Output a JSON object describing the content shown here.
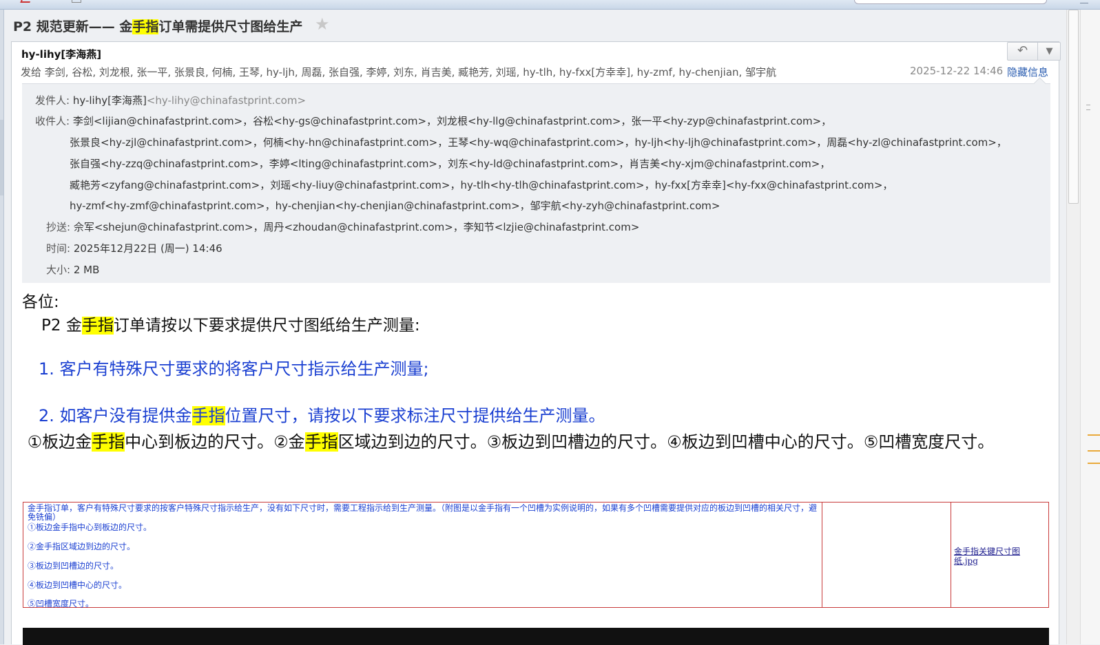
{
  "subject": {
    "before": "P2 规范更新—— 金",
    "highlight": "手指",
    "after": "订单需提供尺寸图给生产"
  },
  "header": {
    "sender": "hy-lihy[李海燕]",
    "to_label": "发给",
    "to_list": "李剑, 谷松, 刘龙根, 张一平, 张景良, 何楠, 王琴, hy-ljh, 周磊, 张自强, 李婷, 刘东, 肖吉美, 臧艳芳, 刘瑶, hy-tlh, hy-fxx[方幸幸], hy-zmf, hy-chenjian, 邹宇航",
    "date": "2025-12-22 14:46",
    "hide_label": "隐藏信息"
  },
  "details": {
    "from_label": "发件人:",
    "from_name": "hy-lihy[李海燕]",
    "from_email": "<hy-lihy@chinafastprint.com>",
    "to_label": "收件人:",
    "to_lines": [
      "李剑<lijian@chinafastprint.com>，谷松<hy-gs@chinafastprint.com>，刘龙根<hy-llg@chinafastprint.com>，张一平<hy-zyp@chinafastprint.com>，",
      "张景良<hy-zjl@chinafastprint.com>，何楠<hy-hn@chinafastprint.com>，王琴<hy-wq@chinafastprint.com>，hy-ljh<hy-ljh@chinafastprint.com>，周磊<hy-zl@chinafastprint.com>，",
      "张自强<hy-zzq@chinafastprint.com>，李婷<lting@chinafastprint.com>，刘东<hy-ld@chinafastprint.com>，肖吉美<hy-xjm@chinafastprint.com>，",
      "臧艳芳<zyfang@chinafastprint.com>，刘瑶<hy-liuy@chinafastprint.com>，hy-tlh<hy-tlh@chinafastprint.com>，hy-fxx[方幸幸]<hy-fxx@chinafastprint.com>，",
      "hy-zmf<hy-zmf@chinafastprint.com>，hy-chenjian<hy-chenjian@chinafastprint.com>，邹宇航<hy-zyh@chinafastprint.com>"
    ],
    "cc_label": "抄送:",
    "cc_value": "佘军<shejun@chinafastprint.com>，周丹<zhoudan@chinafastprint.com>，李知节<lzjie@chinafastprint.com>",
    "time_label": "时间:",
    "time_value": "2025年12月22日 (周一) 14:46",
    "size_label": "大小:",
    "size_value": "2 MB"
  },
  "body": {
    "greeting": "各位:",
    "intro_before": "P2 金",
    "intro_highlight": "手指",
    "intro_after": "订单请按以下要求提供尺寸图纸给生产测量:",
    "item1": "1. 客户有特殊尺寸要求的将客户尺寸指示给生产测量;",
    "item2_before": "2. 如客户没有提供金",
    "item2_highlight": "手指",
    "item2_after": "位置尺寸，请按以下要求标注尺寸提供给生产测量。",
    "line3_a": "①板边金",
    "line3_hl1": "手指",
    "line3_b": "中心到板边的尺寸。②金",
    "line3_hl2": "手指",
    "line3_c": "区域边到边的尺寸。③板边到凹槽边的尺寸。④板边到凹槽中心的尺寸。⑤凹槽宽度尺寸。"
  },
  "embedded_table": {
    "intro": "金手指订单，客户有特殊尺寸要求的按客户特殊尺寸指示给生产，没有如下尺寸时，需要工程指示给到生产测量。（附图是以金手指有一个凹槽为实例说明的，如果有多个凹槽需要提供对应的板边到凹槽的相关尺寸，避免铣偏）",
    "rows": [
      "①板边金手指中心到板边的尺寸。",
      "②金手指区域边到边的尺寸。",
      "③板边到凹槽边的尺寸。",
      "④板边到凹槽中心的尺寸。",
      "⑤凹槽宽度尺寸。"
    ],
    "attachment_link": "金手指关键尺寸图纸.jpg"
  },
  "colors": {
    "highlight": "#ffff00",
    "body_blue": "#1a3fd1",
    "link_blue": "#2a5db0",
    "table_border": "#c83a3a"
  }
}
